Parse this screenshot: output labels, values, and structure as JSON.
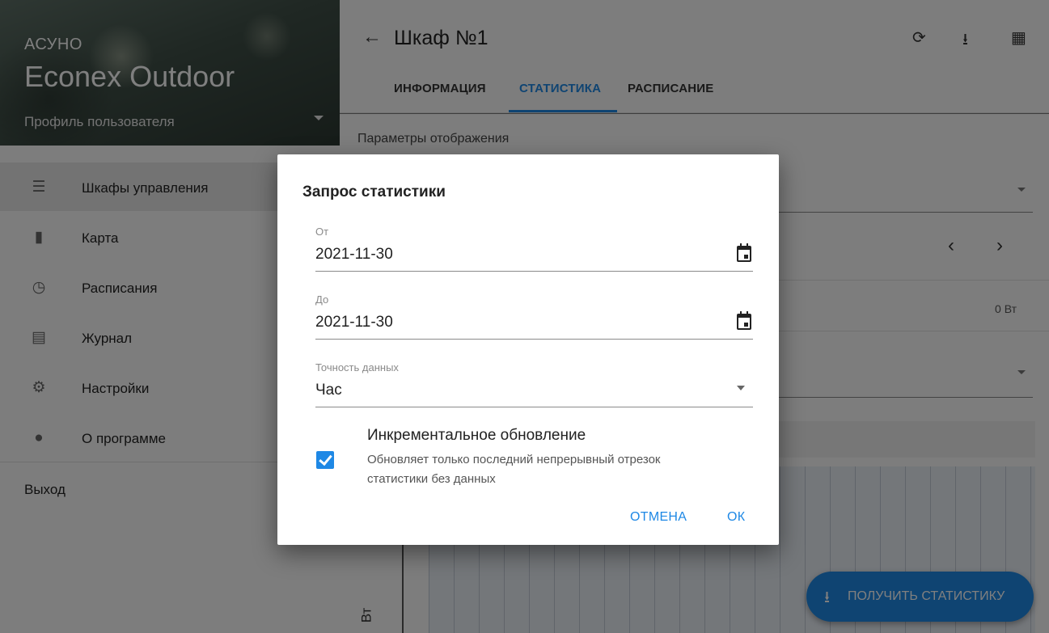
{
  "sidebar": {
    "brand_small": "АСУНО",
    "brand_large": "Econex Outdoor",
    "profile": "Профиль пользователя",
    "items": [
      {
        "label": "Шкафы управления",
        "icon": "cabinet-icon"
      },
      {
        "label": "Карта",
        "icon": "map-icon"
      },
      {
        "label": "Расписания",
        "icon": "clock-icon"
      },
      {
        "label": "Журнал",
        "icon": "journal-icon"
      },
      {
        "label": "Настройки",
        "icon": "gear-icon"
      },
      {
        "label": "О программе",
        "icon": "info-icon"
      }
    ],
    "logout": "Выход"
  },
  "header": {
    "title": "Шкаф №1",
    "tabs": [
      {
        "label": "ИНФОРМАЦИЯ"
      },
      {
        "label": "СТАТИСТИКА"
      },
      {
        "label": "РАСПИСАНИЕ"
      }
    ],
    "active_tab": "СТАТИСТИКА"
  },
  "content": {
    "params_title": "Параметры отображения",
    "power_value": "0 Вт",
    "axis_label": "Вт",
    "fab_label": "ПОЛУЧИТЬ СТАТИСТИКУ"
  },
  "dialog": {
    "title": "Запрос статистики",
    "from_label": "От",
    "from_value": "2021-11-30",
    "to_label": "До",
    "to_value": "2021-11-30",
    "precision_label": "Точность данных",
    "precision_value": "Час",
    "incremental_title": "Инкрементальное обновление",
    "incremental_desc": "Обновляет только последний непрерывный отрезок статистики без данных",
    "incremental_checked": true,
    "cancel": "ОТМЕНА",
    "ok": "ОК"
  },
  "colors": {
    "accent": "#1e88e5",
    "scrim": "#000000"
  }
}
